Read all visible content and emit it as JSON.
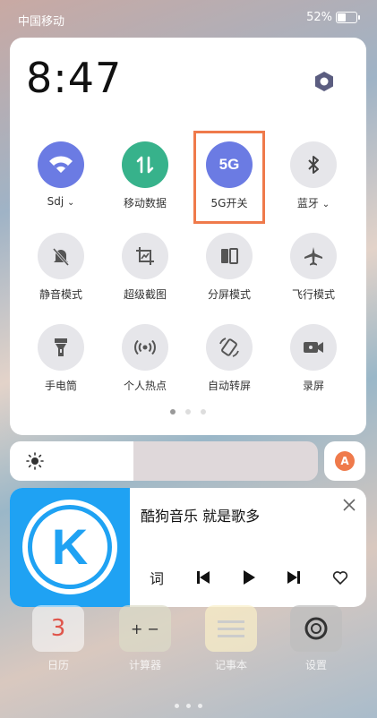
{
  "status_bar": {
    "carrier": "中国移动",
    "battery": "52%",
    "battery_level": 0.52
  },
  "clock": {
    "time": "8:47"
  },
  "toggles": [
    {
      "label": "Sdj",
      "has_dropdown": true,
      "state": "on",
      "icon": "wifi-icon"
    },
    {
      "label": "移动数据",
      "state": "on",
      "icon": "mobile-data-icon"
    },
    {
      "label": "5G开关",
      "state": "on",
      "icon": "5g-icon",
      "icon_text": "5G"
    },
    {
      "label": "蓝牙",
      "has_dropdown": true,
      "state": "off",
      "icon": "bluetooth-icon"
    },
    {
      "label": "静音模式",
      "state": "off",
      "icon": "mute-bell-icon"
    },
    {
      "label": "超级截图",
      "state": "off",
      "icon": "screenshot-icon"
    },
    {
      "label": "分屏模式",
      "state": "off",
      "icon": "split-screen-icon"
    },
    {
      "label": "飞行模式",
      "state": "off",
      "icon": "airplane-icon"
    },
    {
      "label": "手电筒",
      "state": "off",
      "icon": "flashlight-icon"
    },
    {
      "label": "个人热点",
      "state": "off",
      "icon": "hotspot-icon"
    },
    {
      "label": "自动转屏",
      "state": "off",
      "icon": "auto-rotate-icon"
    },
    {
      "label": "录屏",
      "state": "off",
      "icon": "screen-record-icon"
    }
  ],
  "brightness": {
    "level": 0.4,
    "auto_label": "A"
  },
  "music": {
    "title": "酷狗音乐  就是歌多",
    "lyrics_label": "词",
    "cover_letter": "K"
  },
  "home_apps": [
    {
      "label": "日历",
      "icon_text": "3"
    },
    {
      "label": "计算器",
      "icon_text": "+ −"
    },
    {
      "label": "记事本",
      "icon_text": ""
    },
    {
      "label": "设置",
      "icon_text": ""
    }
  ],
  "colors": {
    "accent_blue": "#6b7be3",
    "accent_green": "#37b28b",
    "highlight": "#ef7a4b",
    "kugou_blue": "#1fa2f3"
  }
}
